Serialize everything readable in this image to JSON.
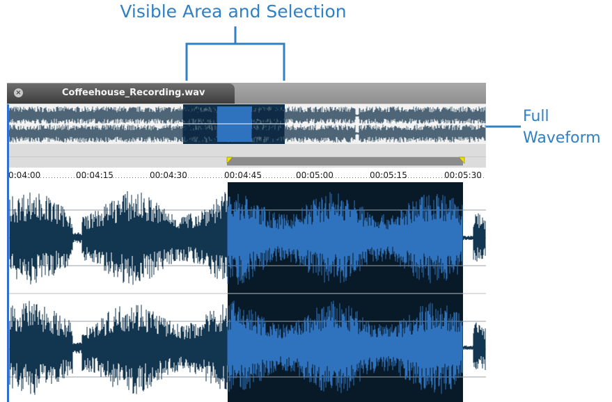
{
  "callouts": {
    "visible_area": "Visible Area and Selection",
    "full_waveform_line1": "Full",
    "full_waveform_line2": "Waveform"
  },
  "colors": {
    "callout": "#2f80c4",
    "waveform": "#123550",
    "selection_bg": "#081a28",
    "selection_wave": "#2f72bd",
    "zoom_handle": "#f0e000"
  },
  "tab": {
    "title": "Coffeehouse_Recording.wav",
    "close_icon": "close-icon"
  },
  "ruler": {
    "labels": [
      "0:04:00",
      "00:04:15",
      "00:04:30",
      "00:04:45",
      "00:05:00",
      "00:05:15",
      "00:05:30"
    ]
  }
}
